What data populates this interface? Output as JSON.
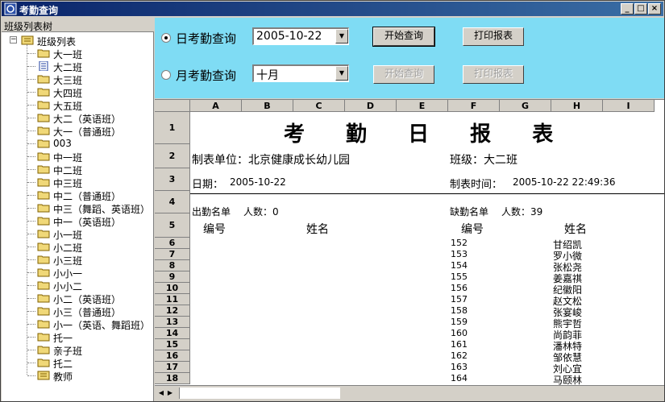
{
  "window": {
    "title": "考勤查询"
  },
  "left": {
    "header": "班级列表树",
    "root": "班级列表",
    "items": [
      "大一班",
      "大二班",
      "大三班",
      "大四班",
      "大五班",
      "大二（英语班）",
      "大一（普通班）",
      "003",
      "中一班",
      "中二班",
      "中三班",
      "中二（普通班）",
      "中三（舞蹈、英语班）",
      "中一（英语班）",
      "小一班",
      "小二班",
      "小三班",
      "小小一",
      "小小二",
      "小二（英语班）",
      "小三（普通班）",
      "小一（英语、舞蹈班）",
      "托一",
      "亲子班",
      "托二",
      "教师"
    ]
  },
  "controls": {
    "daily_label": "日考勤查询",
    "daily_date": "2005-10-22",
    "monthly_label": "月考勤查询",
    "monthly_value": "十月",
    "start_query": "开始查询",
    "print_report": "打印报表",
    "daily_selected": true
  },
  "sheet": {
    "columns": [
      "A",
      "B",
      "C",
      "D",
      "E",
      "F",
      "G",
      "H",
      "I"
    ],
    "rows": [
      "1",
      "2",
      "3",
      "4",
      "5",
      "6",
      "7",
      "8",
      "9",
      "10",
      "11",
      "12",
      "13",
      "14",
      "15",
      "16",
      "17",
      "18"
    ],
    "title": "考 勤 日 报 表",
    "unit": "制表单位：北京健康成长幼儿园",
    "class": "班级：大二班",
    "date_label": "日期：",
    "date_value": "2005-10-22",
    "make_time_label": "制表时间：",
    "make_time_value": "2005-10-22 22:49:36",
    "present_label": "出勤名单",
    "present_count": "人数：0",
    "absent_label": "缺勤名单",
    "absent_count": "人数：39",
    "col_number": "编号",
    "col_name": "姓名",
    "absent": [
      {
        "no": "152",
        "name": "甘绍凯"
      },
      {
        "no": "153",
        "name": "罗小微"
      },
      {
        "no": "154",
        "name": "张松尧"
      },
      {
        "no": "155",
        "name": "姜嘉祺"
      },
      {
        "no": "156",
        "name": "纪徽阳"
      },
      {
        "no": "157",
        "name": "赵文松"
      },
      {
        "no": "158",
        "name": "张宴峻"
      },
      {
        "no": "159",
        "name": "熊宇哲"
      },
      {
        "no": "160",
        "name": "尚韵菲"
      },
      {
        "no": "161",
        "name": "潘林特"
      },
      {
        "no": "162",
        "name": "邹依慧"
      },
      {
        "no": "163",
        "name": "刘心宜"
      },
      {
        "no": "164",
        "name": "马颐林"
      }
    ]
  }
}
